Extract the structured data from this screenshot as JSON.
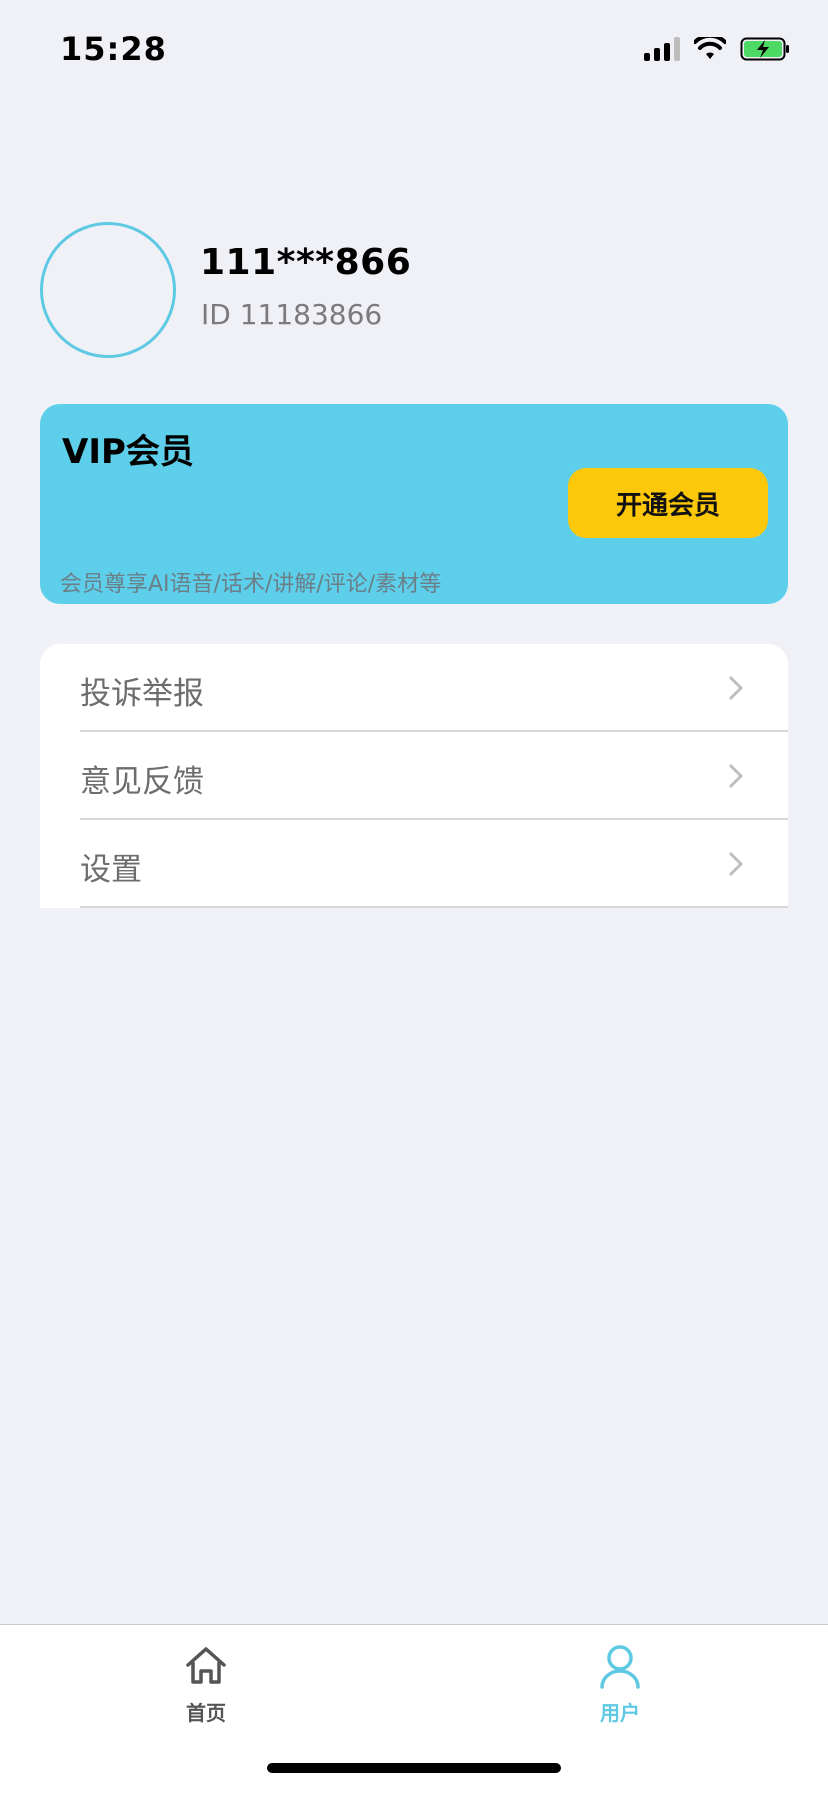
{
  "status_bar": {
    "time": "15:28",
    "icons": [
      "signal-icon",
      "wifi-icon",
      "battery-charging-icon"
    ],
    "battery_color": "#4cd964"
  },
  "profile": {
    "username": "111***866",
    "user_id": "ID 11183866",
    "avatar_border_color": "#5ec9e3"
  },
  "vip": {
    "title": "VIP会员",
    "button_label": "开通会员",
    "description": "会员尊享AI语音/话术/讲解/评论/素材等",
    "card_color": "#5ecfea",
    "button_color": "#fec80a"
  },
  "menu": {
    "items": [
      {
        "label": "投诉举报",
        "icon": "chevron-right-icon"
      },
      {
        "label": "意见反馈",
        "icon": "chevron-right-icon"
      },
      {
        "label": "设置",
        "icon": "chevron-right-icon"
      }
    ]
  },
  "tab_bar": {
    "tabs": [
      {
        "label": "首页",
        "icon": "home-icon",
        "active": false
      },
      {
        "label": "用户",
        "icon": "user-icon",
        "active": true
      }
    ],
    "active_color": "#5ec9e3"
  }
}
